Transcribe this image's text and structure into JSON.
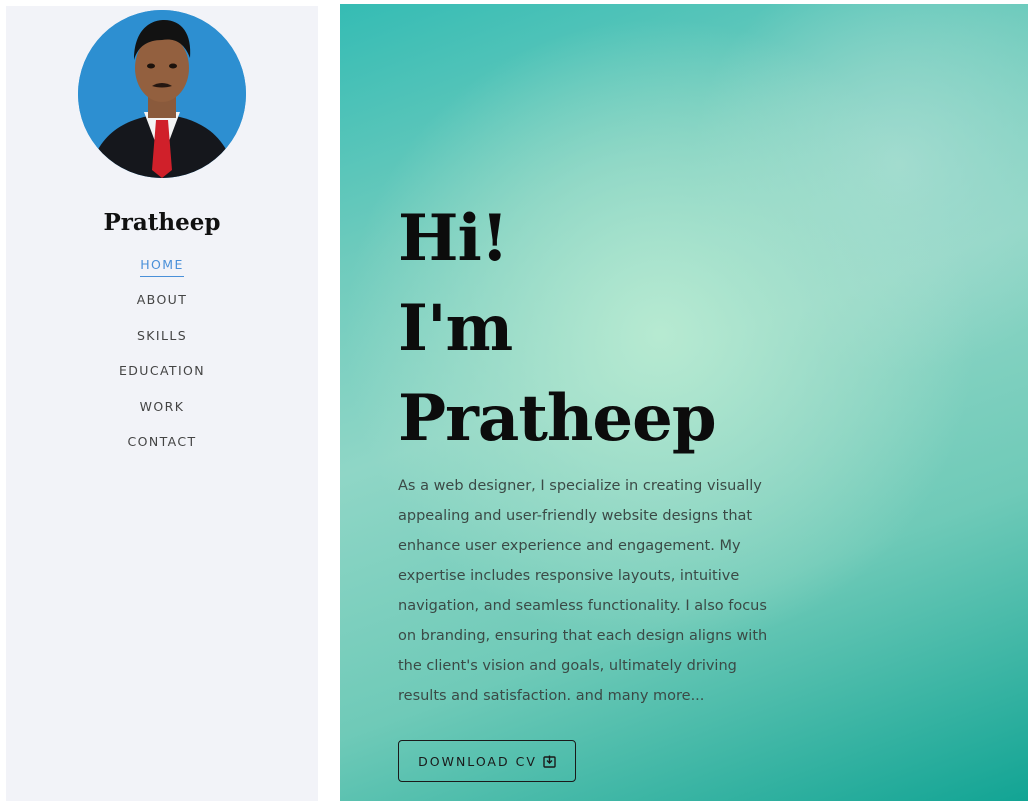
{
  "profile": {
    "name": "Pratheep",
    "avatar_icon": "profile-photo"
  },
  "nav": {
    "items": [
      {
        "label": "HOME",
        "active": true
      },
      {
        "label": "ABOUT",
        "active": false
      },
      {
        "label": "SKILLS",
        "active": false
      },
      {
        "label": "EDUCATION",
        "active": false
      },
      {
        "label": "WORK",
        "active": false
      },
      {
        "label": "CONTACT",
        "active": false
      }
    ]
  },
  "hero": {
    "line1": "Hi!",
    "line2": "I'm",
    "line3": "Pratheep",
    "description": "As a web designer, I specialize in creating visually appealing and user-friendly website designs that enhance user experience and engagement. My expertise includes responsive layouts, intuitive navigation, and seamless functionality. I also focus on branding, ensuring that each design aligns with the client's vision and goals, ultimately driving results and satisfaction. and many more...",
    "download_label": "DOWNLOAD CV",
    "download_icon": "download-icon"
  },
  "colors": {
    "accent": "#4a90d9",
    "sidebar_bg": "#f2f3f8",
    "hero_teal": "#12a494"
  }
}
